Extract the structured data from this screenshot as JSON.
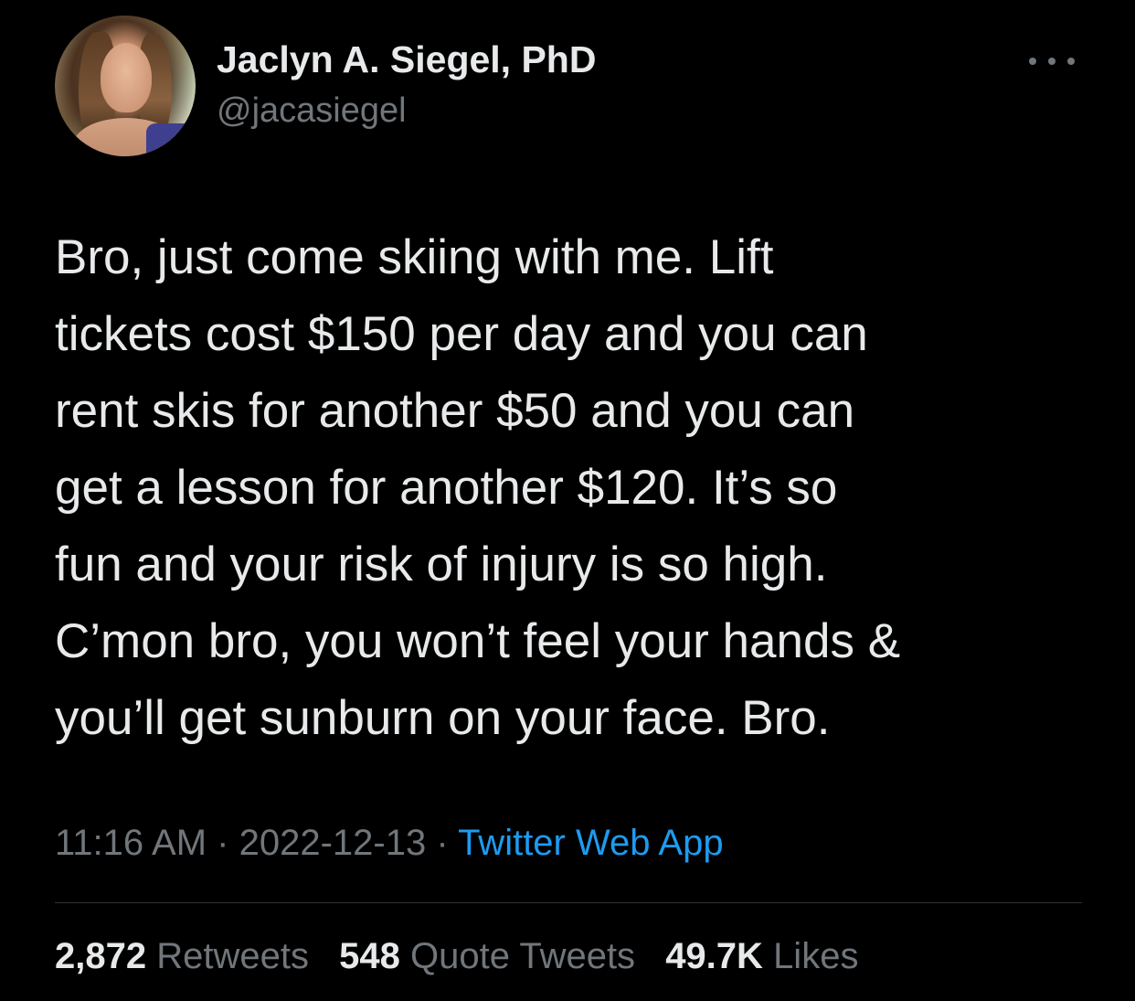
{
  "author": {
    "display_name": "Jaclyn A. Siegel, PhD",
    "handle": "@jacasiegel",
    "avatar_icon": "profile-photo"
  },
  "more_icon": "ellipsis-icon",
  "tweet": {
    "lines": [
      "Bro, just come skiing with me. Lift",
      "tickets cost $150 per day and you can",
      "rent skis for another $50 and you can",
      "get a lesson for another $120. It’s so",
      "fun and your risk of injury is so high.",
      "C’mon bro, you won’t feel your hands &",
      "you’ll get sunburn on your face. Bro."
    ]
  },
  "meta": {
    "time": "11:16 AM",
    "separator": "·",
    "date": "2022-12-13",
    "source": "Twitter Web App"
  },
  "stats": {
    "retweets_count": "2,872",
    "retweets_label": "Retweets",
    "quotes_count": "548",
    "quotes_label": "Quote Tweets",
    "likes_count": "49.7K",
    "likes_label": "Likes"
  },
  "colors": {
    "background": "#000000",
    "text": "#e7e9ea",
    "secondary": "#71767b",
    "link": "#1d9bf0"
  }
}
